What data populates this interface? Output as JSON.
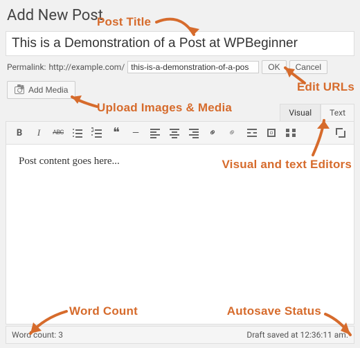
{
  "page_title": "Add New Post",
  "title_input": {
    "value": "This is a Demonstration of a Post at WPBeginner"
  },
  "permalink": {
    "label": "Permalink:",
    "base_url": "http://example.com/",
    "slug": "this-is-a-demonstration-of-a-pos",
    "ok": "OK",
    "cancel": "Cancel"
  },
  "add_media_label": "Add Media",
  "tabs": {
    "visual": "Visual",
    "text": "Text",
    "active": "visual"
  },
  "toolbar": {
    "bold": "B",
    "italic": "I",
    "strike": "ABC",
    "ul": "ul",
    "ol": "ol",
    "quote": "❝",
    "hr": "—",
    "al_left": "",
    "al_center": "",
    "al_right": "",
    "link": "🔗",
    "unlink": "⛓",
    "more": "",
    "fullscreen": "",
    "kitchen": "",
    "expand": ""
  },
  "content_text": "Post content goes here...",
  "status": {
    "word_count_label": "Word count:",
    "word_count": "3",
    "autosave": "Draft saved at 12:36:11 am."
  },
  "annotations": {
    "post_title": "Post Title",
    "edit_urls": "Edit URLs",
    "upload": "Upload Images & Media",
    "editors": "Visual and text Editors",
    "word_count": "Word Count",
    "autosave": "Autosave Status"
  }
}
